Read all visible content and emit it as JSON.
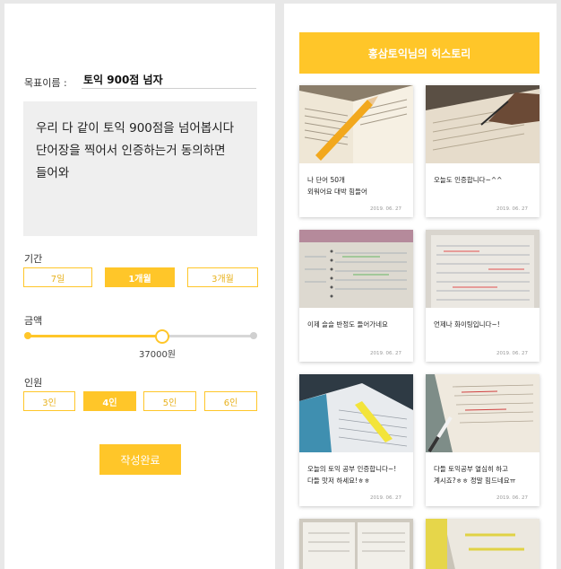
{
  "form": {
    "goal_label": "목표이름 :",
    "goal_value": "토익 900점 넘자",
    "description": "우리 다 같이 토익 900점을 넘어봅시다\n단어장을 찍어서 인증하는거 동의하면\n들어와",
    "period": {
      "label": "기간",
      "options": [
        "7일",
        "1개월",
        "3개월"
      ],
      "selected": "1개월"
    },
    "amount": {
      "label": "금액",
      "value_text": "37000원",
      "fraction": 0.6
    },
    "people": {
      "label": "인원",
      "options": [
        "3인",
        "4인",
        "5인",
        "6인"
      ],
      "selected": "4인"
    },
    "submit_label": "작성완료"
  },
  "history": {
    "title": "홍삼토익님의 히스토리",
    "items": [
      {
        "caption": "나 단어 50개\n외워어요 대박 힘들어",
        "date": "2019. 06. 27"
      },
      {
        "caption": "오늘도 인증합니다~^^",
        "date": "2019. 06. 27"
      },
      {
        "caption": "이제 슬슬 반정도 들어가네요",
        "date": "2019. 06. 27"
      },
      {
        "caption": "언제나 화이팅입니다~!",
        "date": "2019. 06. 27"
      },
      {
        "caption": "오늘의 토익 공부 인증합니다~!\n다들 맛저 하세요!ㅎㅎ",
        "date": "2019. 06. 27"
      },
      {
        "caption": "다들 토익공부 열심히 하고\n계시죠?ㅎㅎ 정말 힘드네요ㅠ",
        "date": "2019. 06. 27"
      }
    ]
  },
  "colors": {
    "accent": "#ffc629",
    "background": "#e8e8e8"
  }
}
